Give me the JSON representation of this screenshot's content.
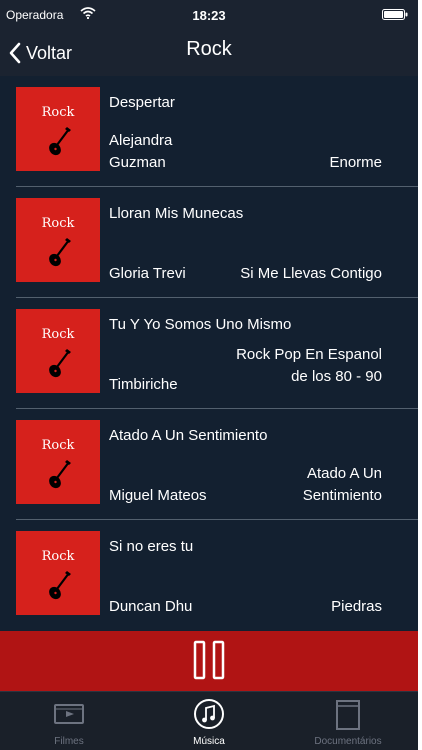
{
  "status_bar": {
    "carrier": "Operadora",
    "time": "18:23"
  },
  "nav": {
    "back_label": "Voltar",
    "title": "Rock"
  },
  "artwork_label": "Rock",
  "songs": [
    {
      "title": "Despertar",
      "artist": "Alejandra Guzman",
      "album": "Enorme"
    },
    {
      "title": "Lloran Mis Munecas",
      "artist": "Gloria Trevi",
      "album": "Si Me Llevas Contigo"
    },
    {
      "title": "Tu Y Yo Somos Uno Mismo",
      "artist": "Timbiriche",
      "album": "Rock Pop En Espanol de los 80 - 90"
    },
    {
      "title": "Atado A Un Sentimiento",
      "artist": "Miguel Mateos",
      "album": "Atado A Un Sentimiento"
    },
    {
      "title": "Si no eres tu",
      "artist": "Duncan Dhu",
      "album": "Piedras"
    }
  ],
  "player": {
    "state_icon": "pause-icon",
    "color": "#b01414"
  },
  "tabs": [
    {
      "label": "Filmes",
      "icon": "film-icon",
      "active": false
    },
    {
      "label": "Música",
      "icon": "music-note-icon",
      "active": true
    },
    {
      "label": "Documentários",
      "icon": "document-icon",
      "active": false
    }
  ],
  "colors": {
    "background": "#1b2330",
    "artwork": "#d6211c",
    "accent": "#b01414",
    "tab_inactive": "#6d7380"
  }
}
